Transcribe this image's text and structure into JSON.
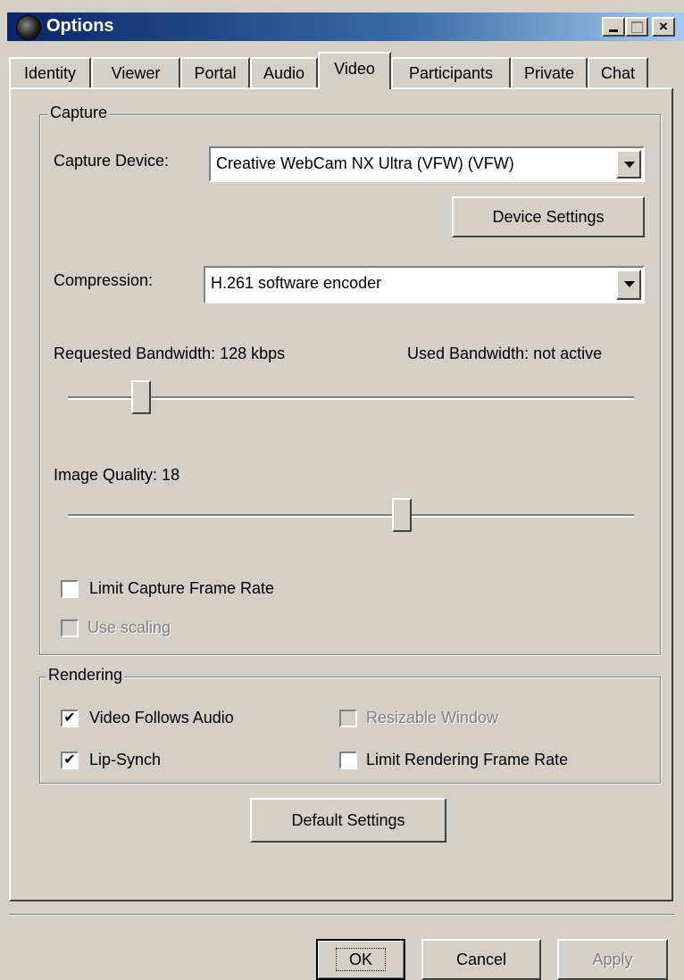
{
  "window": {
    "title": "Options",
    "close_glyph": "×",
    "icons": [
      "app-icon",
      "minimize-icon",
      "maximize-icon",
      "close-icon"
    ]
  },
  "tabs": [
    {
      "label": "Identity"
    },
    {
      "label": "Viewer"
    },
    {
      "label": "Portal"
    },
    {
      "label": "Audio"
    },
    {
      "label": "Video",
      "active": true
    },
    {
      "label": "Participants"
    },
    {
      "label": "Private"
    },
    {
      "label": "Chat"
    }
  ],
  "capture": {
    "legend": "Capture",
    "device_label": "Capture Device:",
    "device_value": "Creative WebCam NX Ultra (VFW) (VFW)",
    "device_settings_button": "Device Settings",
    "compression_label": "Compression:",
    "compression_value": "H.261 software encoder",
    "requested_bandwidth": "Requested Bandwidth: 128 kbps",
    "used_bandwidth": "Used Bandwidth: not active",
    "bandwidth_slider_fraction": 0.13,
    "image_quality": "Image Quality: 18",
    "quality_slider_fraction": 0.59,
    "limit_frame_rate": {
      "label": "Limit Capture Frame Rate",
      "checked": false
    },
    "use_scaling": {
      "label": "Use scaling",
      "checked": false,
      "disabled": true
    }
  },
  "rendering": {
    "legend": "Rendering",
    "video_follows_audio": {
      "label": "Video Follows Audio",
      "checked": true
    },
    "lip_synch": {
      "label": "Lip-Synch",
      "checked": true
    },
    "resizable_window": {
      "label": "Resizable Window",
      "checked": false,
      "disabled": true
    },
    "limit_rendering": {
      "label": "Limit Rendering Frame Rate",
      "checked": false
    }
  },
  "default_settings_button": "Default Settings",
  "buttons": {
    "ok": "OK",
    "cancel": "Cancel",
    "apply": "Apply"
  },
  "check_glyph": "✔"
}
